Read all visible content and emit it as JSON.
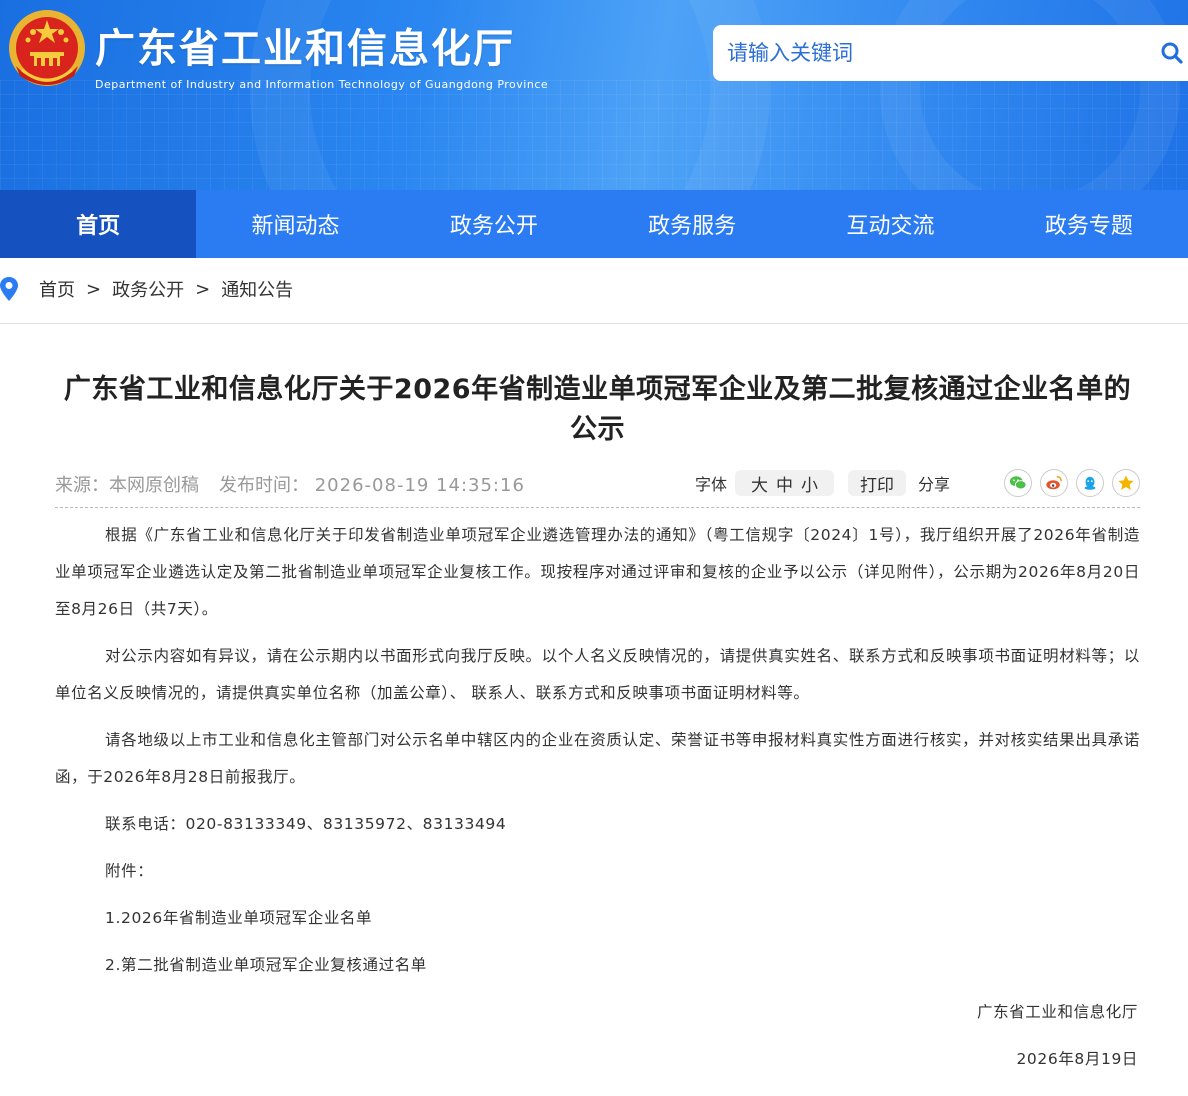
{
  "header": {
    "title": "广东省工业和信息化厅",
    "subtitle": "Department of Industry and Information Technology of Guangdong Province",
    "search_placeholder": "请输入关键词"
  },
  "nav": {
    "items": [
      {
        "label": "首页",
        "active": true
      },
      {
        "label": "新闻动态"
      },
      {
        "label": "政务公开"
      },
      {
        "label": "政务服务"
      },
      {
        "label": "互动交流"
      },
      {
        "label": "政务专题"
      }
    ]
  },
  "breadcrumb": {
    "items": [
      "首页",
      "政务公开",
      "通知公告"
    ],
    "separator": ">"
  },
  "article": {
    "title": "广东省工业和信息化厅关于2026年省制造业单项冠军企业及第二批复核通过企业名单的公示",
    "source": "来源：本网原创稿",
    "publish_time_label": "发布时间：",
    "publish_time": "2026-08-19 14:35:16",
    "font_label": "字体",
    "font_sizes": [
      "大",
      "中",
      "小"
    ],
    "print_label": "打印",
    "share_label": "分享",
    "share_icons": [
      "wechat-icon",
      "weibo-icon",
      "qq-icon",
      "qzone-icon"
    ],
    "paragraphs": [
      "根据《广东省工业和信息化厅关于印发省制造业单项冠军企业遴选管理办法的通知》（粤工信规字〔2024〕1号），我厅组织开展了2026年省制造业单项冠军企业遴选认定及第二批省制造业单项冠军企业复核工作。现按程序对通过评审和复核的企业予以公示（详见附件），公示期为2026年8月20日至8月26日（共7天）。",
      "对公示内容如有异议，请在公示期内以书面形式向我厅反映。以个人名义反映情况的，请提供真实姓名、联系方式和反映事项书面证明材料等；以单位名义反映情况的，请提供真实单位名称（加盖公章）、 联系人、联系方式和反映事项书面证明材料等。",
      "请各地级以上市工业和信息化主管部门对公示名单中辖区内的企业在资质认定、荣誉证书等申报材料真实性方面进行核实，并对核实结果出具承诺函，于2026年8月28日前报我厅。"
    ],
    "contact": "联系电话：020-83133349、83135972、83133494",
    "attachment_label": "附件：",
    "attachments": [
      "1.2026年省制造业单项冠军企业名单",
      "2.第二批省制造业单项冠军企业复核通过名单"
    ],
    "signature": "广东省工业和信息化厅",
    "date": "2026年8月19日"
  },
  "colors": {
    "nav_bg": "#2b7cf2",
    "nav_active": "#1552bf",
    "banner": "#2a86f0"
  }
}
